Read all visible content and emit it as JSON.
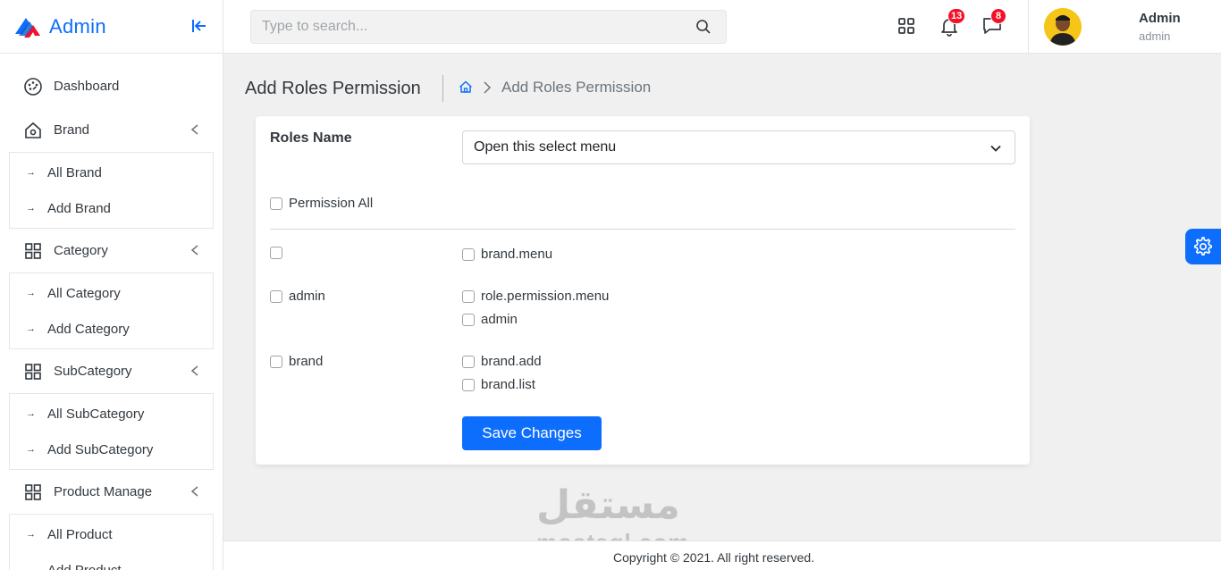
{
  "sidebar": {
    "brand": "Admin",
    "menu": [
      {
        "label": "Dashboard",
        "icon": "dashboard-icon",
        "children": []
      },
      {
        "label": "Brand",
        "icon": "home-icon",
        "children": [
          "All Brand",
          "Add Brand"
        ]
      },
      {
        "label": "Category",
        "icon": "grid-icon",
        "children": [
          "All Category",
          "Add Category"
        ]
      },
      {
        "label": "SubCategory",
        "icon": "grid-icon",
        "children": [
          "All SubCategory",
          "Add SubCategory"
        ]
      },
      {
        "label": "Product Manage",
        "icon": "grid-icon",
        "children": [
          "All Product",
          "Add Product"
        ]
      }
    ]
  },
  "topbar": {
    "search_placeholder": "Type to search...",
    "notifications_count": "13",
    "messages_count": "8",
    "user_name": "Admin",
    "user_role": "admin"
  },
  "page": {
    "title": "Add Roles Permission",
    "breadcrumb_current": "Add Roles Permission"
  },
  "form": {
    "roles_label": "Roles Name",
    "select_value": "Open this select menu",
    "permission_all_label": "Permission All",
    "groups": [
      {
        "group": "",
        "permissions": [
          "brand.menu"
        ]
      },
      {
        "group": "admin",
        "permissions": [
          "role.permission.menu",
          "admin"
        ]
      },
      {
        "group": "brand",
        "permissions": [
          "brand.add",
          "brand.list"
        ]
      }
    ],
    "save_label": "Save Changes"
  },
  "watermark": {
    "arabic": "مستقل",
    "latin": "mostaql.com"
  },
  "footer": {
    "copyright": "Copyright © 2021. All right reserved."
  },
  "colors": {
    "primary": "#0d6efd",
    "badge": "#f41127"
  }
}
